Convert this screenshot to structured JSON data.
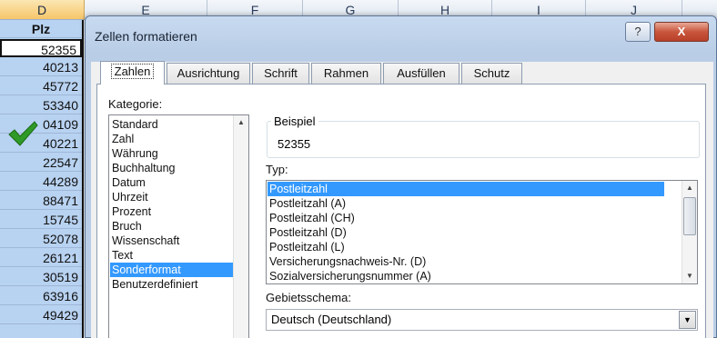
{
  "sheet": {
    "columns": [
      "D",
      "E",
      "F",
      "G",
      "H",
      "I",
      "J"
    ],
    "header_cell": "Plz",
    "values": [
      "52355",
      "40213",
      "45772",
      "53340",
      "04109",
      "40221",
      "22547",
      "44289",
      "88471",
      "15745",
      "52078",
      "26121",
      "30519",
      "63916",
      "49429"
    ]
  },
  "dialog": {
    "title": "Zellen formatieren",
    "help_label": "?",
    "close_label": "X",
    "tabs": [
      "Zahlen",
      "Ausrichtung",
      "Schrift",
      "Rahmen",
      "Ausfüllen",
      "Schutz"
    ],
    "category_label": "Kategorie:",
    "categories": [
      "Standard",
      "Zahl",
      "Währung",
      "Buchhaltung",
      "Datum",
      "Uhrzeit",
      "Prozent",
      "Bruch",
      "Wissenschaft",
      "Text",
      "Sonderformat",
      "Benutzerdefiniert"
    ],
    "selected_category": "Sonderformat",
    "sample_label": "Beispiel",
    "sample_value": "52355",
    "type_label": "Typ:",
    "types": [
      "Postleitzahl",
      "Postleitzahl (A)",
      "Postleitzahl (CH)",
      "Postleitzahl (D)",
      "Postleitzahl (L)",
      "Versicherungsnachweis-Nr. (D)",
      "Sozialversicherungsnummer (A)"
    ],
    "selected_type": "Postleitzahl",
    "locale_label": "Gebietsschema:",
    "locale_value": "Deutsch (Deutschland)"
  },
  "colors": {
    "selection": "#3399ff",
    "column_highlight": "#b8d2f1",
    "checkmark": "#2f9a27",
    "close_button": "#c8563c"
  },
  "icons": [
    "checkmark-icon",
    "help-icon",
    "close-icon",
    "scroll-up-icon",
    "scroll-down-icon",
    "dropdown-arrow-icon"
  ]
}
